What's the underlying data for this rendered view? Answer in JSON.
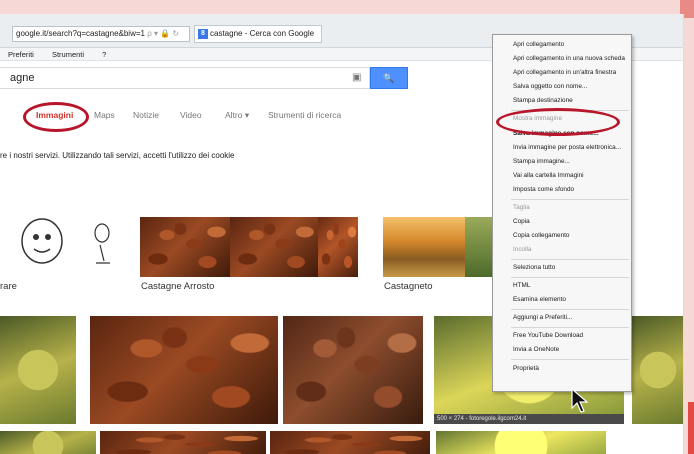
{
  "browser": {
    "address": "google.it/search?q=castagne&biw=1",
    "address_icons": "ρ ▾ 🔒 ↻",
    "tab_label": "castagne - Cerca con Google",
    "tab_close": "×",
    "favicon": "8",
    "menus": [
      "Preferiti",
      "Strumenti",
      "?"
    ]
  },
  "search": {
    "query": "agne",
    "button_icon": "🔍",
    "camera_icon": "▣"
  },
  "tabs": {
    "immagini": "Immagini",
    "maps": "Maps",
    "notizie": "Notizie",
    "video": "Video",
    "altro": "Altro ▾",
    "strumenti": "Strumenti di ricerca"
  },
  "cookie_notice": "re i nostri servizi. Utilizzando tali servizi, accetti l'utilizzo dei cookie",
  "captions": {
    "c1": "rare",
    "c2": "Castagne Arrosto",
    "c3": "Castagneto"
  },
  "tooltip": "500 × 274 - fotoregole.ilgcom24.it",
  "context_menu": {
    "items": [
      {
        "label": "Apri collegamento",
        "disabled": false
      },
      {
        "label": "Apri collegamento in una nuova scheda",
        "disabled": false
      },
      {
        "label": "Apri collegamento in un'altra finestra",
        "disabled": false
      },
      {
        "label": "Salva oggetto con nome...",
        "disabled": false
      },
      {
        "label": "Stampa destinazione",
        "disabled": false
      },
      {
        "label": "Mostra immagine",
        "disabled": true
      },
      {
        "label": "Salva immagine con nome...",
        "disabled": false
      },
      {
        "label": "Invia immagine per posta elettronica...",
        "disabled": false
      },
      {
        "label": "Stampa immagine...",
        "disabled": false
      },
      {
        "label": "Vai alla cartella Immagini",
        "disabled": false
      },
      {
        "label": "Imposta come sfondo",
        "disabled": false
      },
      {
        "label": "Taglia",
        "disabled": true
      },
      {
        "label": "Copia",
        "disabled": false
      },
      {
        "label": "Copia collegamento",
        "disabled": false
      },
      {
        "label": "Incolla",
        "disabled": true
      },
      {
        "label": "Seleziona tutto",
        "disabled": false
      },
      {
        "label": "HTML",
        "disabled": false
      },
      {
        "label": "Esamina elemento",
        "disabled": false
      },
      {
        "label": "Aggiungi a Preferiti...",
        "disabled": false
      },
      {
        "label": "Free YouTube Download",
        "disabled": false
      },
      {
        "label": "Invia a OneNote",
        "disabled": false
      },
      {
        "label": "Proprietà",
        "disabled": false
      }
    ]
  },
  "colors": {
    "highlight_oval": "#b8172b",
    "google_blue": "#4d90fe",
    "active_tab": "#d0302a"
  }
}
